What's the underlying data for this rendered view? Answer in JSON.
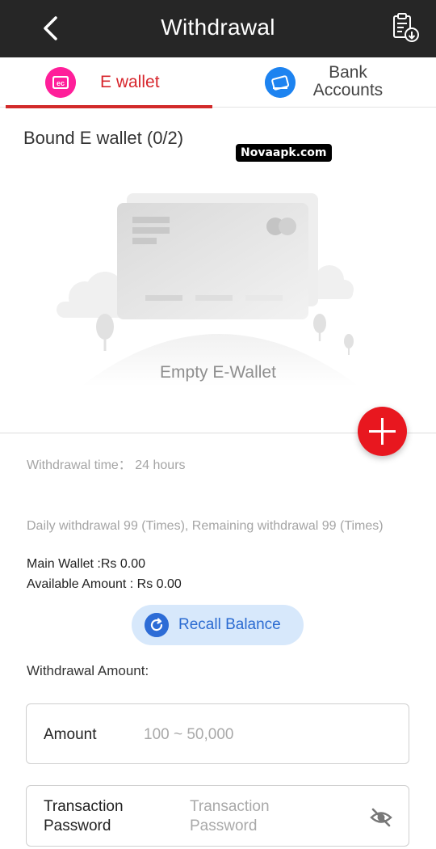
{
  "header": {
    "title": "Withdrawal",
    "back_icon": "chevron-left-icon",
    "history_icon": "clipboard-download-icon"
  },
  "tabs": [
    {
      "label": "E wallet",
      "icon": "e-wallet-icon",
      "active": true,
      "color": "#d7252c"
    },
    {
      "label": "Bank Accounts",
      "line1": "Bank",
      "line2": "Accounts",
      "icon": "bank-card-icon",
      "active": false
    }
  ],
  "bound": {
    "title": "Bound E wallet (0/2)",
    "empty_label": "Empty E-Wallet"
  },
  "watermark": "Novaapk.com",
  "info": {
    "withdrawal_time": "Withdrawal time：  24 hours",
    "daily": "Daily withdrawal 99 (Times), Remaining withdrawal 99 (Times)",
    "main_wallet": "Main Wallet :Rs 0.00",
    "available": "Available Amount : Rs 0.00"
  },
  "recall": {
    "label": "Recall Balance",
    "icon": "refresh-icon"
  },
  "form": {
    "amount_title": "Withdrawal Amount:",
    "amount_label": "Amount",
    "amount_placeholder": "100 ~ 50,000",
    "password_label_1": "Transaction",
    "password_label_2": "Password",
    "password_placeholder": "Transaction Password",
    "password_ph_1": "Transaction",
    "password_ph_2": "Password",
    "eye_icon": "eye-off-icon"
  },
  "colors": {
    "accent": "#d22a2a",
    "header_bg": "#262626",
    "fab": "#e8171f",
    "recall_bg": "#d7e8fb",
    "recall_text": "#2b6bd1"
  }
}
